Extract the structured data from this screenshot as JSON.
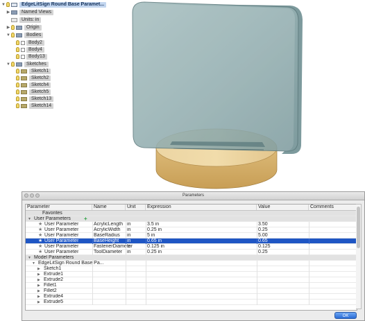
{
  "browser": {
    "items": [
      {
        "label": "EdgeLitSign Round Base Paramet..."
      },
      {
        "label": "Named Views"
      },
      {
        "label": "Units: in"
      },
      {
        "label": "Origin"
      },
      {
        "label": "Bodies"
      },
      {
        "label": "Body2"
      },
      {
        "label": "Body4"
      },
      {
        "label": "Body13"
      },
      {
        "label": "Sketches"
      },
      {
        "label": "Sketch1"
      },
      {
        "label": "Sketch2"
      },
      {
        "label": "Sketch4"
      },
      {
        "label": "Sketch5"
      },
      {
        "label": "Sketch13"
      },
      {
        "label": "Sketch14"
      }
    ]
  },
  "dialog": {
    "title": "Parameters",
    "columns": [
      "Parameter",
      "Name",
      "Unit",
      "Expression",
      "Value",
      "Comments"
    ],
    "favorites_label": "Favorites",
    "user_params_label": "User Parameters",
    "user_params": [
      {
        "type": "User Parameter",
        "name": "AcrylicLength",
        "unit": "in",
        "expression": "3.5 in",
        "value": "3.50"
      },
      {
        "type": "User Parameter",
        "name": "AcrylicWidth",
        "unit": "in",
        "expression": "0.25 in",
        "value": "0.25"
      },
      {
        "type": "User Parameter",
        "name": "BaseRadius",
        "unit": "in",
        "expression": "5 in",
        "value": "5.00"
      },
      {
        "type": "User Parameter",
        "name": "BaseHeight",
        "unit": "in",
        "expression": "0.65 in",
        "value": "0.65"
      },
      {
        "type": "User Parameter",
        "name": "FastenerDiameter",
        "unit": "in",
        "expression": "0.125 in",
        "value": "0.125"
      },
      {
        "type": "User Parameter",
        "name": "ToolDiameter",
        "unit": "in",
        "expression": "0.25 in",
        "value": "0.25"
      }
    ],
    "model_params_label": "Model Parameters",
    "model_root_label": "EdgeLitSign Round Base Pa...",
    "features": [
      "Sketch1",
      "Extrude1",
      "Extrude2",
      "Fillet1",
      "Fillet2",
      "Extrude4",
      "Extrude5"
    ],
    "ok_label": "OK"
  }
}
